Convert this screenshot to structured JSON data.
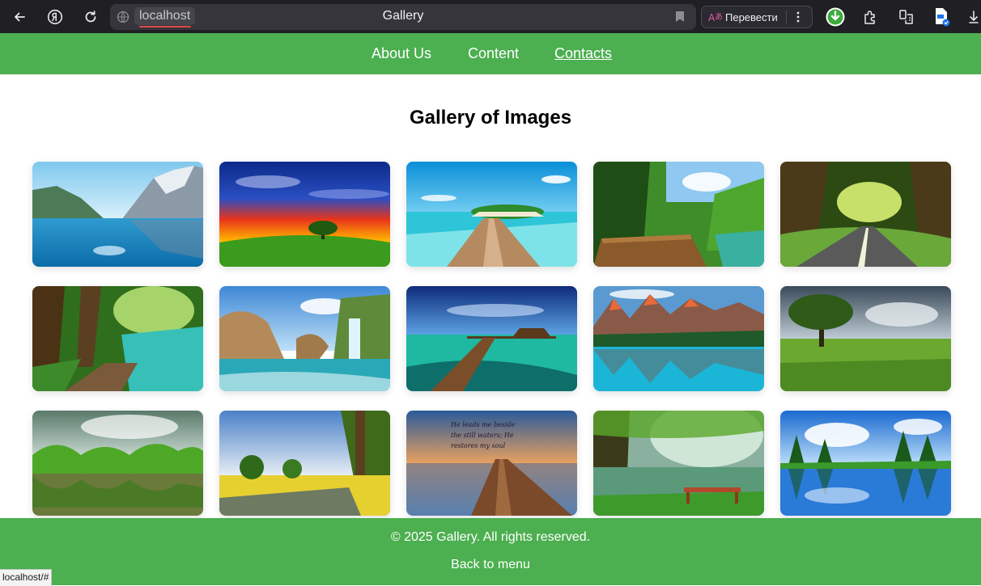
{
  "browser": {
    "url": "localhost",
    "tab_title": "Gallery",
    "translate_label": "Перевести",
    "status_url": "localhost/#"
  },
  "nav": {
    "items": [
      {
        "label": "About Us",
        "active": false
      },
      {
        "label": "Content",
        "active": false
      },
      {
        "label": "Contacts",
        "active": true
      }
    ]
  },
  "main": {
    "title": "Gallery of Images",
    "images": [
      {
        "name": "lake-mountains"
      },
      {
        "name": "sunset-tree"
      },
      {
        "name": "tropical-pier"
      },
      {
        "name": "forest-boardwalk"
      },
      {
        "name": "tree-tunnel-road"
      },
      {
        "name": "forest-path-lake"
      },
      {
        "name": "rock-waterfall"
      },
      {
        "name": "overwater-bungalow-pier"
      },
      {
        "name": "moraine-lake"
      },
      {
        "name": "tree-field"
      },
      {
        "name": "river-trees"
      },
      {
        "name": "country-road"
      },
      {
        "name": "sunset-dock-verse",
        "caption": "He leads me beside the still waters; He restores my soul"
      },
      {
        "name": "bench-lake"
      },
      {
        "name": "pine-reflection"
      }
    ]
  },
  "footer": {
    "copyright": "© 2025 Gallery. All rights reserved.",
    "back_link": "Back to menu"
  },
  "colors": {
    "accent": "#4caf50",
    "browser_bg": "#1f1f24"
  }
}
